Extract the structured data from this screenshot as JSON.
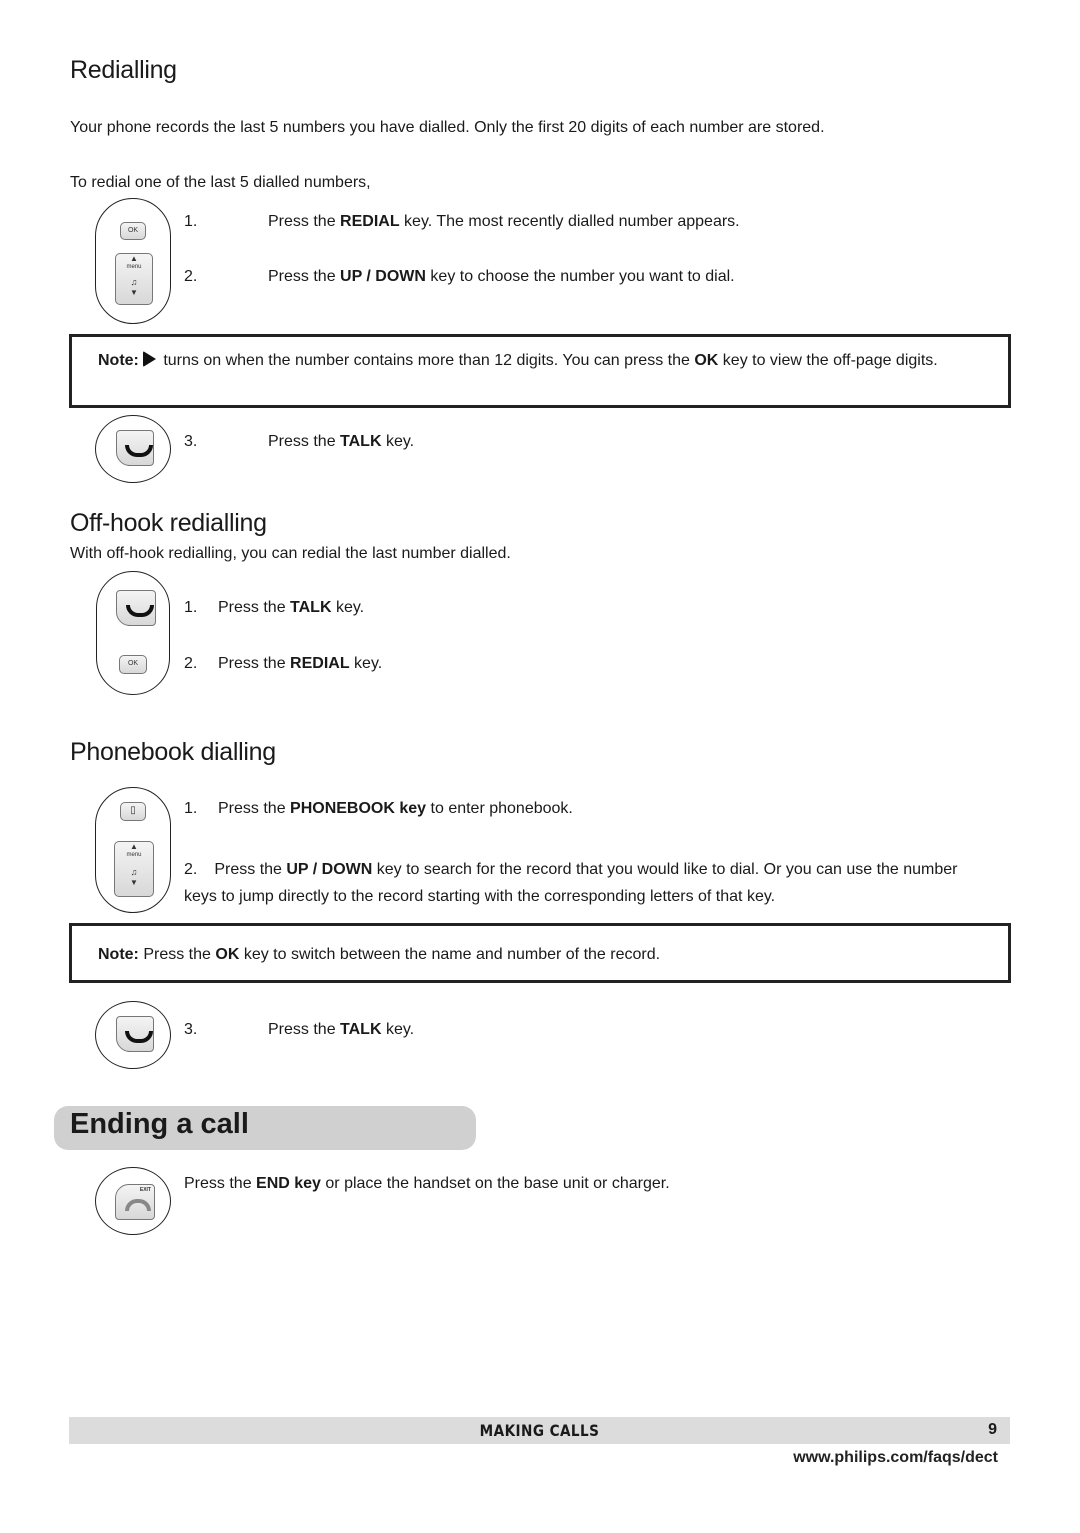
{
  "redialling": {
    "title": "Redialling",
    "intro": "Your phone records the last 5 numbers you have dialled.  Only the first 20 digits of each number are stored.",
    "lead": "To redial one of the last 5 dialled numbers,",
    "steps": [
      {
        "num": "1.",
        "pre": "Press the ",
        "key": "REDIAL",
        "post": " key.  The most recently dialled number appears."
      },
      {
        "num": "2.",
        "pre": "Press the ",
        "key": "UP / DOWN",
        "post": " key to choose the number you want to dial."
      },
      {
        "num": "3.",
        "pre": "Press the ",
        "key": "TALK",
        "post": " key."
      }
    ],
    "note": {
      "label": "Note:",
      "icon": "right-arrow-icon",
      "pre": " turns on when the number contains more than 12 digits. You can press the ",
      "key": "OK",
      "post": " key to view the off-page digits."
    },
    "key_labels": {
      "ok": "OK",
      "menu": "menu"
    }
  },
  "offhook": {
    "title": "Off-hook redialling",
    "intro": "With off-hook redialling, you can redial the last number dialled.",
    "steps": [
      {
        "num": "1.",
        "pre": "Press the ",
        "key": "TALK",
        "post": " key."
      },
      {
        "num": "2.",
        "pre": "Press the ",
        "key": "REDIAL",
        "post": " key."
      }
    ]
  },
  "phonebook": {
    "title": "Phonebook dialling",
    "steps": [
      {
        "num": "1.",
        "pre": "Press the ",
        "key": "PHONEBOOK key",
        "post": " to enter phonebook."
      },
      {
        "num": "2.",
        "pre": "Press the ",
        "key": "UP / DOWN",
        "post": " key to search for the record that you would like to dial.  Or you can use the number keys to jump directly to the record starting with the corresponding letters of that key."
      },
      {
        "num": "3.",
        "pre": "Press the ",
        "key": "TALK",
        "post": " key."
      }
    ],
    "note": {
      "label": "Note:",
      "pre": " Press the ",
      "key": "OK",
      "post": " key to switch between the name and number of the record."
    }
  },
  "ending": {
    "title": "Ending a call",
    "pre": "Press the ",
    "key": "END key",
    "post": " or place the handset on the base unit or charger.",
    "key_label": "EXIT"
  },
  "footer": {
    "section": "MAKING CALLS",
    "page": "9",
    "url": "www.philips.com/faqs/dect"
  }
}
